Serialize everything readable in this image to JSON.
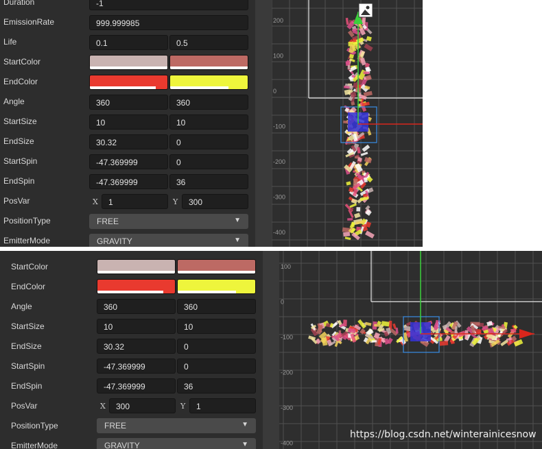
{
  "panel_a": {
    "rows": [
      {
        "label": "Duration",
        "kind": "single",
        "value": "-1"
      },
      {
        "label": "EmissionRate",
        "kind": "single",
        "value": "999.999985"
      },
      {
        "label": "Life",
        "kind": "pair",
        "a": "0.1",
        "b": "0.5"
      },
      {
        "label": "StartColor",
        "kind": "colors",
        "a_color": "#c9b3b1",
        "b_color": "#bd6a64"
      },
      {
        "label": "EndColor",
        "kind": "colors",
        "a_color": "#e93a2f",
        "b_color": "#eef53c"
      },
      {
        "label": "Angle",
        "kind": "pair",
        "a": "360",
        "b": "360"
      },
      {
        "label": "StartSize",
        "kind": "pair",
        "a": "10",
        "b": "10"
      },
      {
        "label": "EndSize",
        "kind": "pair",
        "a": "30.32",
        "b": "0"
      },
      {
        "label": "StartSpin",
        "kind": "pair",
        "a": "-47.369999",
        "b": "0"
      },
      {
        "label": "EndSpin",
        "kind": "pair",
        "a": "-47.369999",
        "b": "36"
      },
      {
        "label": "PosVar",
        "kind": "xy",
        "x_label": "X",
        "x": "1",
        "y_label": "Y",
        "y": "300"
      },
      {
        "label": "PositionType",
        "kind": "select",
        "value": "FREE"
      },
      {
        "label": "EmitterMode",
        "kind": "select",
        "value": "GRAVITY"
      }
    ],
    "ruler": [
      "200",
      "100",
      "0",
      "-100",
      "-200",
      "-300",
      "-400"
    ],
    "axis_direction": "vertical"
  },
  "panel_b": {
    "rows": [
      {
        "label": "StartColor",
        "kind": "colors",
        "a_color": "#c9b3b1",
        "b_color": "#bd6a64"
      },
      {
        "label": "EndColor",
        "kind": "colors",
        "a_color": "#e93a2f",
        "b_color": "#eef53c"
      },
      {
        "label": "Angle",
        "kind": "pair",
        "a": "360",
        "b": "360"
      },
      {
        "label": "StartSize",
        "kind": "pair",
        "a": "10",
        "b": "10"
      },
      {
        "label": "EndSize",
        "kind": "pair",
        "a": "30.32",
        "b": "0"
      },
      {
        "label": "StartSpin",
        "kind": "pair",
        "a": "-47.369999",
        "b": "0"
      },
      {
        "label": "EndSpin",
        "kind": "pair",
        "a": "-47.369999",
        "b": "36"
      },
      {
        "label": "PosVar",
        "kind": "xy",
        "x_label": "X",
        "x": "300",
        "y_label": "Y",
        "y": "1"
      },
      {
        "label": "PositionType",
        "kind": "select",
        "value": "FREE"
      },
      {
        "label": "EmitterMode",
        "kind": "select",
        "value": "GRAVITY"
      }
    ],
    "ruler": [
      "100",
      "0",
      "-100",
      "-200",
      "-300",
      "-400"
    ],
    "axis_direction": "horizontal"
  },
  "icons": {
    "dropdown": "caret-down-icon",
    "scene_image": "image-icon",
    "arrow_up": "green-arrow-icon",
    "arrow_right": "red-arrow-icon"
  },
  "colors": {
    "panel_bg": "#2d2d2d",
    "field_bg": "#1f1f1f",
    "scene_bg": "#2e2e2e",
    "grid": "#555555",
    "selection": "#3a8ee6",
    "axis_y": "#3cd13c",
    "axis_x": "#d9261c"
  },
  "watermark": "https://blog.csdn.net/winterainicesnow"
}
